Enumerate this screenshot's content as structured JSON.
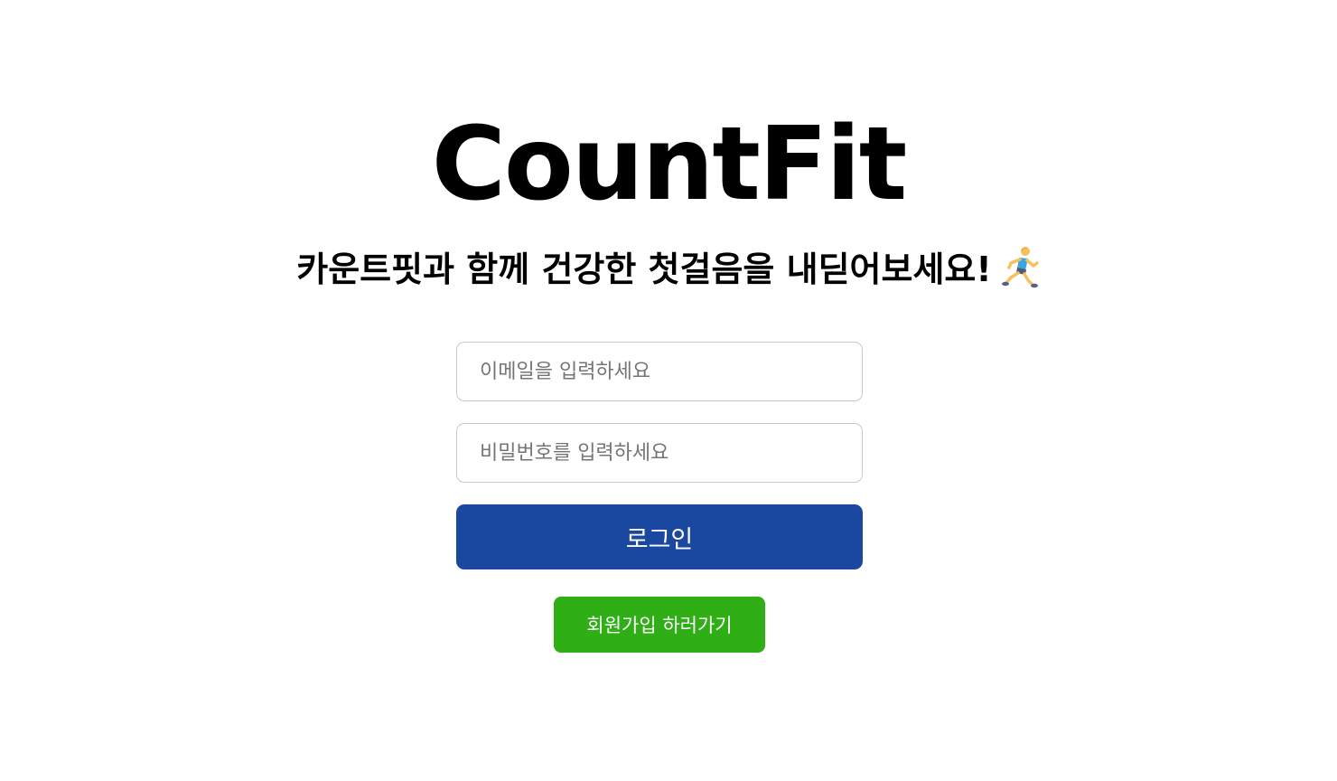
{
  "brand": {
    "title": "CountFit"
  },
  "tagline": {
    "text": "카운트핏과 함께 건강한 첫걸음을 내딛어보세요!",
    "icon": "person-running-icon"
  },
  "login_form": {
    "email_placeholder": "이메일을 입력하세요",
    "email_value": "",
    "password_placeholder": "비밀번호를 입력하세요",
    "password_value": "",
    "submit_label": "로그인"
  },
  "signup": {
    "label": "회원가입 하러가기"
  },
  "colors": {
    "login_button": "#1a47a0",
    "signup_button": "#2fae16",
    "input_border": "#c9c9c9",
    "placeholder": "#757575"
  }
}
